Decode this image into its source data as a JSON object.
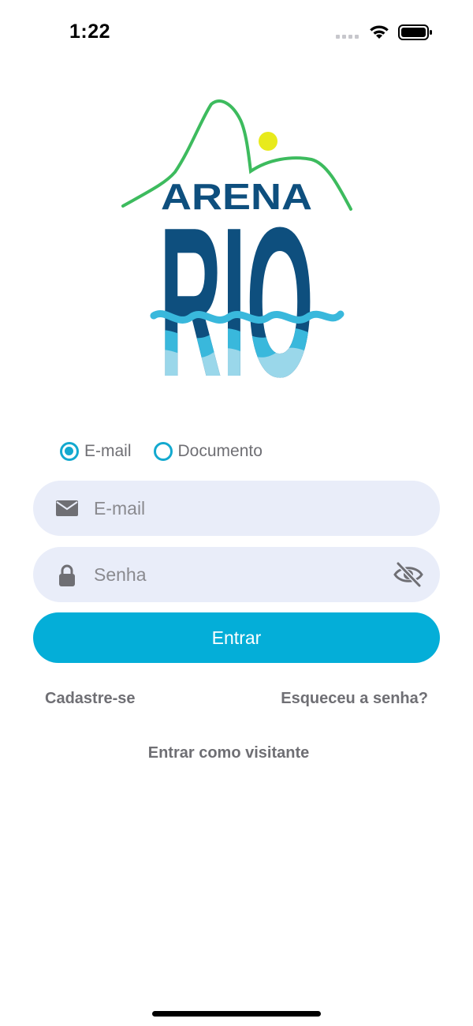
{
  "status_bar": {
    "time": "1:22"
  },
  "logo": {
    "text_top": "ARENA",
    "text_main": "RIO",
    "colors": {
      "mountain": "#3dbb5e",
      "ball": "#e8ea1c",
      "text": "#0e4f7e",
      "wave_light": "#39b8dc",
      "wave_pale": "#9ad7ea"
    }
  },
  "login_type": {
    "options": [
      {
        "label": "E-mail",
        "selected": true
      },
      {
        "label": "Documento",
        "selected": false
      }
    ]
  },
  "email_field": {
    "placeholder": "E-mail",
    "icon": "envelope-icon"
  },
  "password_field": {
    "placeholder": "Senha",
    "icon": "lock-icon",
    "toggle_icon": "eye-off-icon"
  },
  "login_button": {
    "label": "Entrar"
  },
  "links": {
    "register": "Cadastre-se",
    "forgot_password": "Esqueceu a senha?",
    "guest": "Entrar como visitante"
  },
  "theme": {
    "accent": "#04aed8",
    "field_background": "#e9edf9",
    "text_muted": "#6f6f74"
  }
}
